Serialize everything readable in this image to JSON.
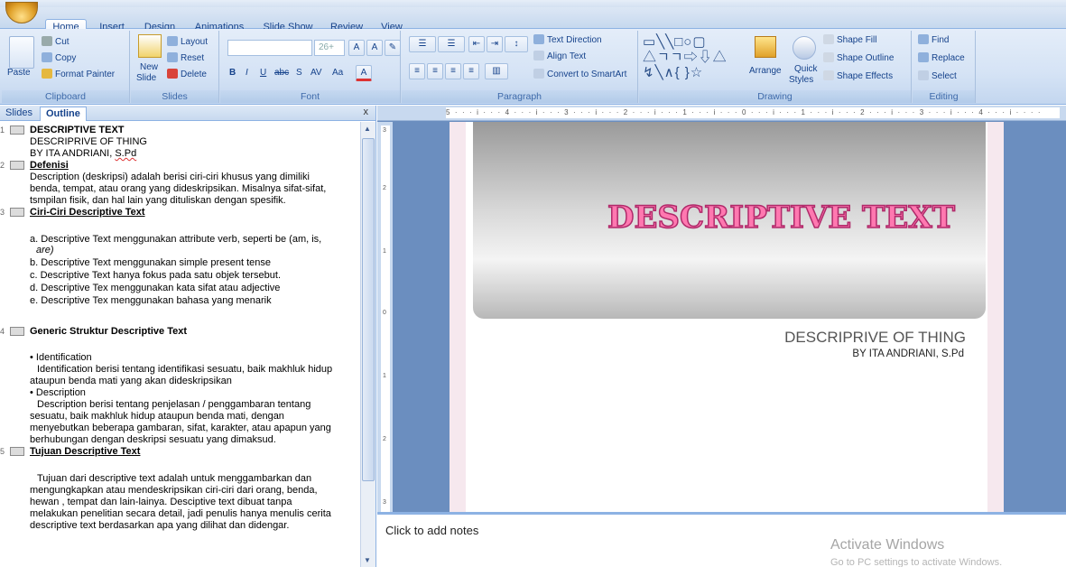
{
  "ribbon_tabs": [
    "Home",
    "Insert",
    "Design",
    "Animations",
    "Slide Show",
    "Review",
    "View"
  ],
  "ribbon": {
    "clipboard": {
      "paste": "Paste",
      "cut": "Cut",
      "copy": "Copy",
      "format_painter": "Format Painter",
      "label": "Clipboard"
    },
    "slides": {
      "new_slide": "New",
      "new_slide2": "Slide",
      "layout": "Layout",
      "reset": "Reset",
      "delete": "Delete",
      "label": "Slides"
    },
    "font": {
      "size": "26+",
      "label": "Font"
    },
    "paragraph": {
      "text_direction": "Text Direction",
      "align_text": "Align Text",
      "convert": "Convert to SmartArt",
      "label": "Paragraph"
    },
    "drawing": {
      "arrange": "Arrange",
      "quick_styles": "Quick",
      "quick_styles2": "Styles",
      "shape_fill": "Shape Fill",
      "shape_outline": "Shape Outline",
      "shape_effects": "Shape Effects",
      "label": "Drawing"
    },
    "editing": {
      "find": "Find",
      "replace": "Replace",
      "select": "Select",
      "label": "Editing"
    }
  },
  "left_pane": {
    "tab_slides": "Slides",
    "tab_outline": "Outline",
    "close": "x"
  },
  "outline": {
    "slide1": {
      "num": "1",
      "title": "DESCRIPTIVE TEXT",
      "l1": "DESCRIPRIVE  OF THING",
      "l2a": "BY ITA ANDRIANI, ",
      "l2b": "S.Pd"
    },
    "slide2": {
      "num": "2",
      "title": "Defenisi",
      "l1": "Description (deskripsi) adalah berisi ciri-ciri khusus yang dimiliki",
      "l2": "benda, tempat, atau orang yang dideskripsikan. Misalnya sifat-sifat,",
      "l3": "tsmpilan fisik, dan hal lain yang dituliskan dengan  spesifik."
    },
    "slide3": {
      "num": "3",
      "title": "Ciri-Ciri Descriptive Text",
      "a": "a. Descriptive Text menggunakan  attribute verb, seperti be (am, is,",
      "a2": "are)",
      "b": "b. Descriptive Text menggunakan  simple present tense",
      "c": "c. Descriptive Text hanya fokus pada satu objek tersebut.",
      "d": "d. Descriptive Tex menggunakan  kata sifat atau adjective",
      "e": "e. Descriptive Tex menggunakan  bahasa yang menarik"
    },
    "slide4": {
      "num": "4",
      "title": "Generic Struktur  Descriptive Text",
      "b1": "• Identification",
      "b1a": "Identification  berisi tentang identifikasi sesuatu, baik makhluk hidup",
      "b1b": "ataupun benda mati yang akan dideskripsikan",
      "b2": "• Description",
      "b2a": "Description berisi tentang penjelasan / penggambaran  tentang",
      "b2b": "sesuatu, baik makhluk hidup ataupun benda mati, dengan",
      "b2c": "menyebutkan beberapa gambaran,  sifat, karakter, atau apapun yang",
      "b2d": "berhubungan  dengan deskripsi sesuatu  yang dimaksud."
    },
    "slide5": {
      "num": "5",
      "title": "Tujuan Descriptive Text",
      "l1": "Tujuan dari descriptive text adalah untuk  menggambarkan dan",
      "l2": "mengungkapkan atau mendeskripsikan ciri-ciri dari orang, benda,",
      "l3": "hewan , tempat dan lain-lainya. Desciptive text dibuat tanpa",
      "l4": "melakukan penelitian secara detail, jadi penulis hanya menulis cerita",
      "l5": "descriptive text berdasarkan apa yang dilihat dan didengar."
    }
  },
  "ruler": {
    "h": "5 · · · i · · · 4 · · · i · · · 3 · · · i · · · 2 · · · i · · · 1 · · · i · · · 0 · · · i · · · 1 · · · i · · · 2 · · · i · · · 3 · · · i · · · 4 · · · i · · · ·",
    "v": [
      "3",
      "2",
      "1",
      "0",
      "1",
      "2",
      "3"
    ]
  },
  "slide": {
    "title": "DESCRIPTIVE TEXT",
    "subtitle": "DESCRIPRIVE  OF THING",
    "byline": "BY ITA ANDRIANI, S.Pd"
  },
  "notes": {
    "placeholder": "Click to add notes"
  },
  "watermark": {
    "line1": "Activate Windows",
    "line2": "Go to PC settings to activate Windows."
  }
}
